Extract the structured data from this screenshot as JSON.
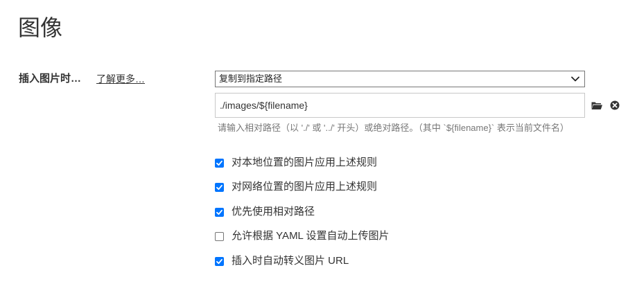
{
  "section": {
    "title": "图像"
  },
  "insert_image": {
    "label": "插入图片时…",
    "learn_more": "了解更多…",
    "action_select": {
      "selected": "复制到指定路径",
      "icon": "chevron-down-icon"
    },
    "path_input": {
      "value": "./images/${filename}",
      "folder_icon": "folder-icon",
      "clear_icon": "clear-circle-icon"
    },
    "hint": "请输入相对路径（以 './' 或 '../' 开头）或绝对路径。（其中 `${filename}` 表示当前文件名）"
  },
  "options": [
    {
      "label": "对本地位置的图片应用上述规则",
      "checked": true
    },
    {
      "label": "对网络位置的图片应用上述规则",
      "checked": true
    },
    {
      "label": "优先使用相对路径",
      "checked": true
    },
    {
      "label": "允许根据 YAML 设置自动上传图片",
      "checked": false
    },
    {
      "label": "插入时自动转义图片 URL",
      "checked": true
    }
  ],
  "colors": {
    "checkbox_accent": "#0075ff",
    "text": "#333333",
    "hint_text": "#777777"
  }
}
